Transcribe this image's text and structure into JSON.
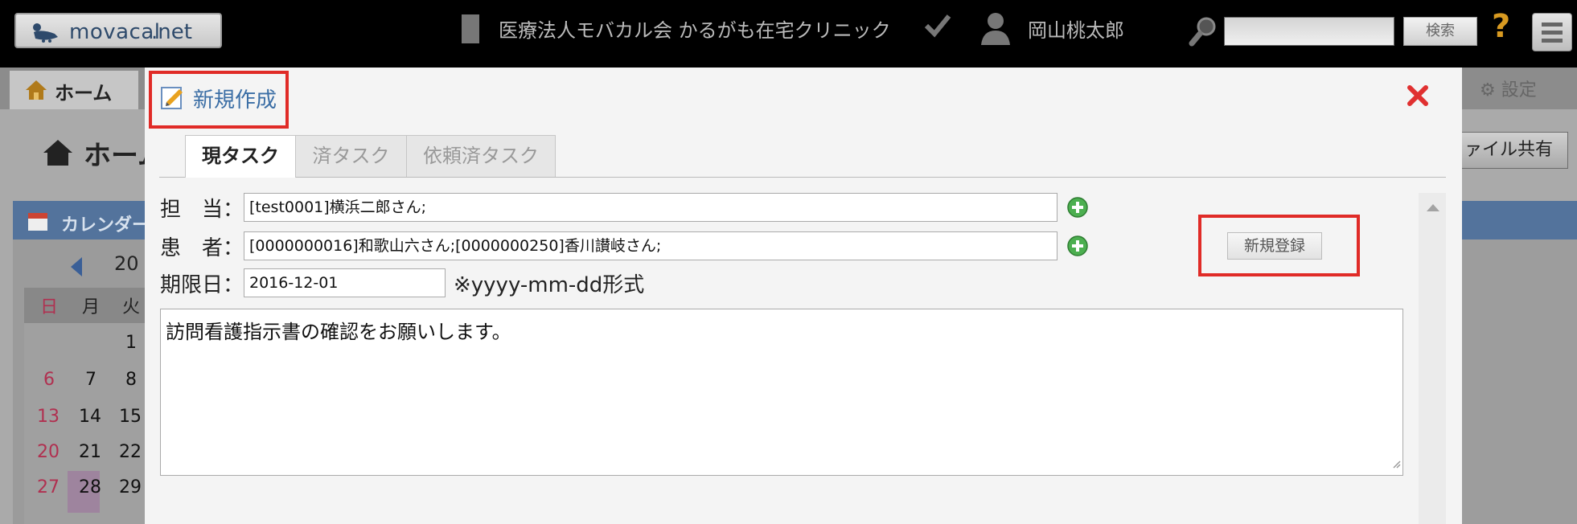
{
  "header": {
    "logo_text_1": "movacal",
    "logo_text_2": ".net",
    "clinic_name": "医療法人モバカル会 かるがも在宅クリニック",
    "user_name": "岡山桃太郎",
    "search_button": "検索",
    "help_label": "?"
  },
  "nav": {
    "home_label": "ホーム",
    "settings_label": "設定"
  },
  "background": {
    "home_title": "ホーム",
    "file_share_button": "ファイル共有",
    "calendar_title": "カレンダー",
    "calendar_year": "20",
    "weekdays": [
      "日",
      "月",
      "火"
    ],
    "days": [
      [
        "",
        "",
        "1"
      ],
      [
        "6",
        "7",
        "8"
      ],
      [
        "13",
        "14",
        "15"
      ],
      [
        "20",
        "21",
        "22"
      ],
      [
        "27",
        "28",
        "29"
      ]
    ]
  },
  "modal": {
    "title": "新規作成",
    "tabs": [
      {
        "label": "現タスク",
        "active": true
      },
      {
        "label": "済タスク",
        "active": false
      },
      {
        "label": "依頼済タスク",
        "active": false
      }
    ],
    "assignee_label": "担　当：",
    "assignee_value": "[test0001]横浜二郎さん;",
    "patient_label": "患　者：",
    "patient_value": "[0000000016]和歌山六さん;[0000000250]香川讃岐さん;",
    "due_label": "期限日：",
    "due_value": "2016-12-01",
    "due_hint": "※yyyy-mm-dd形式",
    "register_button": "新規登録",
    "memo_text": "訪問看護指示書の確認をお願いします。"
  },
  "colors": {
    "highlight": "#e02b27",
    "title_blue": "#3b6ea5",
    "add_green": "#4caf50",
    "close_red": "#e03030"
  }
}
